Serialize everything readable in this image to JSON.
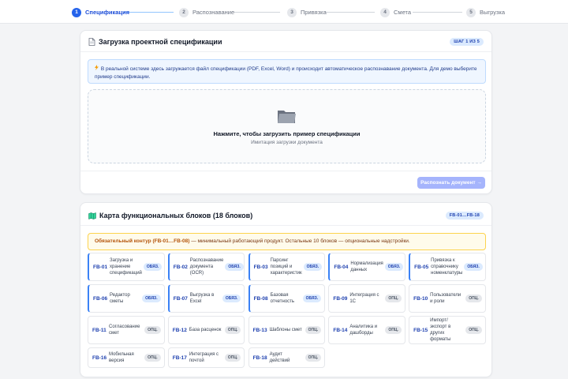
{
  "stepper": {
    "steps": [
      {
        "num": "1",
        "label": "Спецификация",
        "active": true
      },
      {
        "num": "2",
        "label": "Распознавание",
        "active": false
      },
      {
        "num": "3",
        "label": "Привязка",
        "active": false
      },
      {
        "num": "4",
        "label": "Смета",
        "active": false
      },
      {
        "num": "5",
        "label": "Выгрузка",
        "active": false
      }
    ]
  },
  "upload": {
    "icon": "document-icon",
    "title": "Загрузка проектной спецификации",
    "step_badge": "ШАГ 1 ИЗ 5",
    "info_icon": "lightning-icon",
    "info_text": "В реальной системе здесь загружается файл спецификации (PDF, Excel, Word) и происходит автоматическое распознавание документа. Для демо выберите пример спецификации.",
    "drop_icon": "folder-icon",
    "drop_title": "Нажмите, чтобы загрузить пример спецификации",
    "drop_subtitle": "Имитация загрузки документа",
    "recognize_button": "Распознать документ →"
  },
  "blocks": {
    "icon": "map-icon",
    "title": "Карта функциональных блоков (18 блоков)",
    "range_badge": "FB-01…FB-18",
    "warning_bold": "Обязательный контур (FB-01…FB-08)",
    "warning_text": " — минимальный работающий продукт. Остальные 10 блоков — опциональные надстройки.",
    "items": [
      {
        "code": "FB-01",
        "name": "Загрузка и хранение спецификаций",
        "badge": "ОБЯЗ.",
        "mandatory": true
      },
      {
        "code": "FB-02",
        "name": "Распознавание документа (OCR)",
        "badge": "ОБЯЗ.",
        "mandatory": true
      },
      {
        "code": "FB-03",
        "name": "Парсинг позиций и характеристик",
        "badge": "ОБЯЗ.",
        "mandatory": true
      },
      {
        "code": "FB-04",
        "name": "Нормализация данных",
        "badge": "ОБЯЗ.",
        "mandatory": true
      },
      {
        "code": "FB-05",
        "name": "Привязка к справочнику номенклатуры",
        "badge": "ОБЯЗ.",
        "mandatory": true
      },
      {
        "code": "FB-06",
        "name": "Редактор сметы",
        "badge": "ОБЯЗ.",
        "mandatory": true
      },
      {
        "code": "FB-07",
        "name": "Выгрузка в Excel",
        "badge": "ОБЯЗ.",
        "mandatory": true
      },
      {
        "code": "FB-08",
        "name": "Базовая отчетность",
        "badge": "ОБЯЗ.",
        "mandatory": true
      },
      {
        "code": "FB-09",
        "name": "Интеграция с 1С",
        "badge": "ОПЦ.",
        "mandatory": false
      },
      {
        "code": "FB-10",
        "name": "Пользователи и роли",
        "badge": "ОПЦ.",
        "mandatory": false
      },
      {
        "code": "FB-11",
        "name": "Согласование смет",
        "badge": "ОПЦ.",
        "mandatory": false
      },
      {
        "code": "FB-12",
        "name": "База расценок",
        "badge": "ОПЦ.",
        "mandatory": false
      },
      {
        "code": "FB-13",
        "name": "Шаблоны смет",
        "badge": "ОПЦ.",
        "mandatory": false
      },
      {
        "code": "FB-14",
        "name": "Аналитика и дашборды",
        "badge": "ОПЦ.",
        "mandatory": false
      },
      {
        "code": "FB-15",
        "name": "Импорт/экспорт в других форматы",
        "badge": "ОПЦ.",
        "mandatory": false
      },
      {
        "code": "FB-16",
        "name": "Мобильная версия",
        "badge": "ОПЦ.",
        "mandatory": false
      },
      {
        "code": "FB-17",
        "name": "Интеграция с почтой",
        "badge": "ОПЦ.",
        "mandatory": false
      },
      {
        "code": "FB-18",
        "name": "Аудит действий",
        "badge": "ОПЦ.",
        "mandatory": false
      }
    ]
  }
}
